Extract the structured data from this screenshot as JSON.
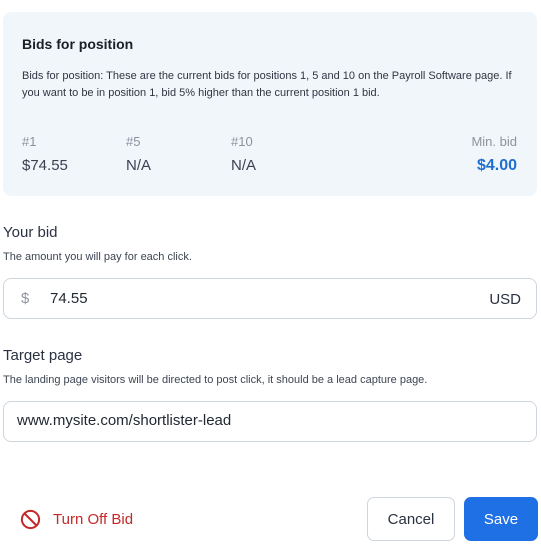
{
  "bids_card": {
    "title": "Bids for position",
    "description": "Bids for position: These are the current bids for positions 1, 5 and 10 on the Payroll Software page. If you want to be in position 1, bid 5% higher than the current position 1 bid.",
    "positions": [
      {
        "label": "#1",
        "value": "$74.55"
      },
      {
        "label": "#5",
        "value": "N/A"
      },
      {
        "label": "#10",
        "value": "N/A"
      }
    ],
    "min_bid_label": "Min. bid",
    "min_bid_value": "$4.00"
  },
  "your_bid": {
    "title": "Your bid",
    "help": "The amount you will pay for each click.",
    "currency_symbol": "$",
    "value": "74.55",
    "unit": "USD"
  },
  "target_page": {
    "title": "Target page",
    "help": "The landing page visitors will be directed to post click, it should be a lead capture page.",
    "value": "www.mysite.com/shortlister-lead"
  },
  "actions": {
    "turn_off_label": "Turn Off Bid",
    "cancel_label": "Cancel",
    "save_label": "Save"
  },
  "colors": {
    "accent": "#1f6fe5",
    "min_bid": "#1f6fcf",
    "danger": "#c62828",
    "card_bg": "#f1f6fb"
  },
  "icons": {
    "turn_off": "prohibited-icon"
  }
}
